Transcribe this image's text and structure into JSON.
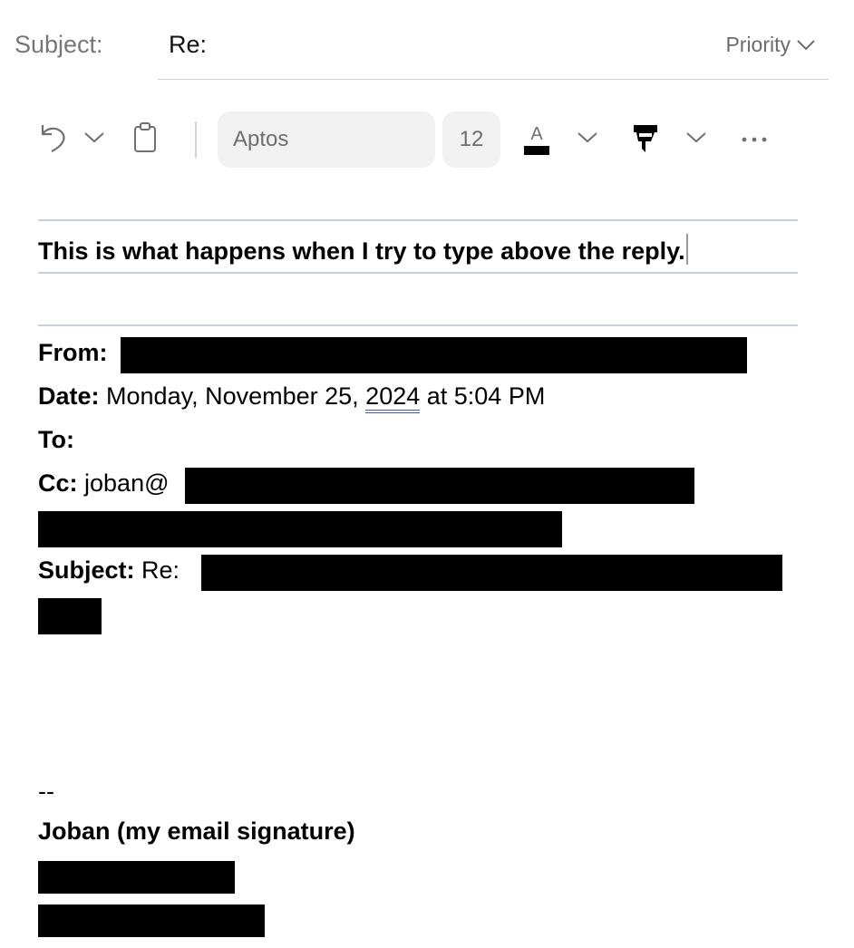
{
  "subject": {
    "label": "Subject:",
    "value": "Re:"
  },
  "priority": {
    "label": "Priority"
  },
  "toolbar": {
    "undo_icon": "undo-icon",
    "paste_icon": "clipboard-icon",
    "font_name": "Aptos",
    "font_size": "12",
    "font_color_icon": "font-color-icon",
    "highlight_icon": "highlighter-icon",
    "more_icon": "more-icon",
    "font_color_letter": "A"
  },
  "body": {
    "typed_line": "This is what happens when I try to type above the reply."
  },
  "quoted_header": {
    "from_label": "From:",
    "date_label": "Date:",
    "date_pre": "Monday, November 25, ",
    "date_year": "2024",
    "date_post": " at 5:04 PM",
    "to_label": "To:",
    "cc_label": "Cc:",
    "cc_value": "joban@",
    "subject_label": "Subject:",
    "subject_value": "Re:"
  },
  "signature": {
    "dash": "--",
    "name": "Joban (my email signature)"
  },
  "colors": {
    "divider": "#c9d0da",
    "toolbar_box": "#f1f1f1",
    "muted_text": "#767676",
    "link_underline": "#3b56c9"
  }
}
